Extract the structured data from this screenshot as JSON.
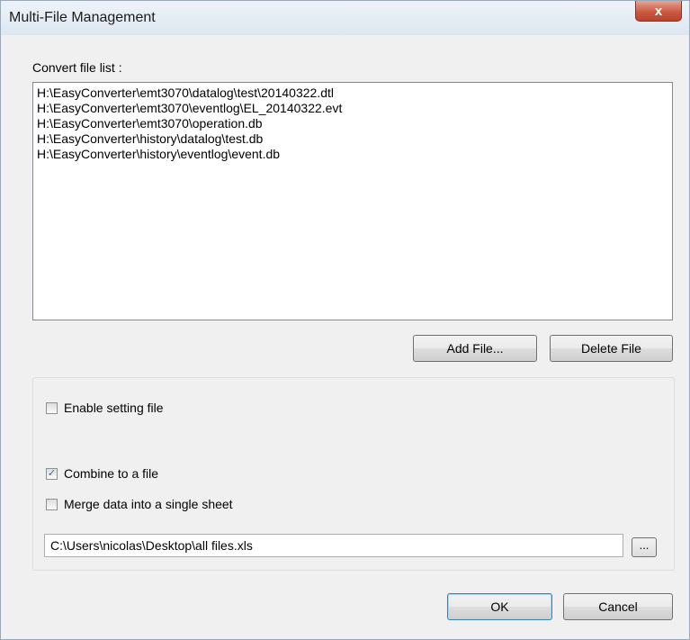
{
  "window": {
    "title": "Multi-File Management",
    "close_glyph": "x"
  },
  "convert_list": {
    "label": "Convert file list :",
    "files": [
      "H:\\EasyConverter\\emt3070\\datalog\\test\\20140322.dtl",
      "H:\\EasyConverter\\emt3070\\eventlog\\EL_20140322.evt",
      "H:\\EasyConverter\\emt3070\\operation.db",
      "H:\\EasyConverter\\history\\datalog\\test.db",
      "H:\\EasyConverter\\history\\eventlog\\event.db"
    ]
  },
  "buttons": {
    "add_file": "Add File...",
    "delete_file": "Delete File",
    "browse": "...",
    "ok": "OK",
    "cancel": "Cancel"
  },
  "options": {
    "enable_setting": {
      "label": "Enable setting file",
      "checked": false
    },
    "combine": {
      "label": "Combine to a file",
      "checked": true
    },
    "merge": {
      "label": "Merge data into a single sheet",
      "checked": false
    },
    "output_path": "C:\\Users\\nicolas\\Desktop\\all files.xls"
  },
  "colors": {
    "close_button": "#c95a42",
    "default_button_border": "#3c7fb1"
  }
}
